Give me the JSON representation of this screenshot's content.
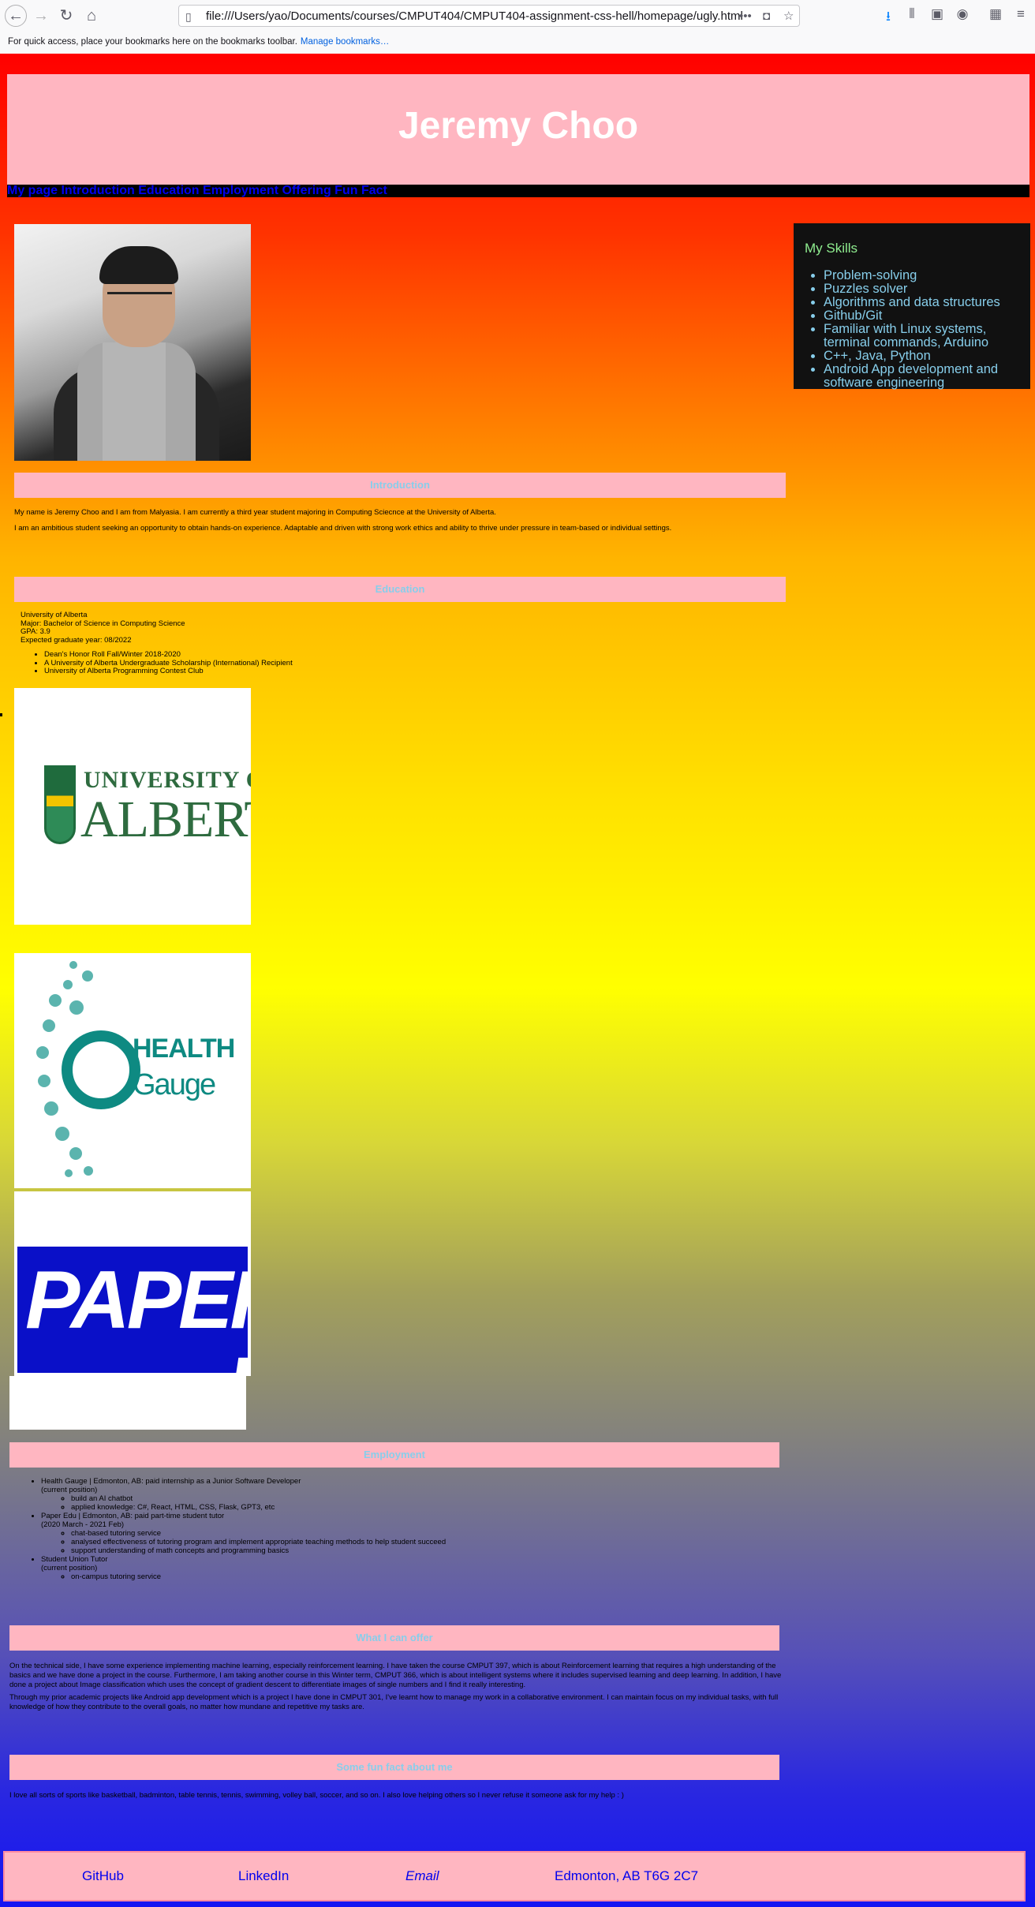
{
  "browser": {
    "url": "file:///Users/yao/Documents/courses/CMPUT404/CMPUT404-assignment-css-hell/homepage/ugly.html",
    "bookmarks_hint": "For quick access, place your bookmarks here on the bookmarks toolbar.",
    "manage_bookmarks": "Manage bookmarks…"
  },
  "header": {
    "title": "Jeremy Choo"
  },
  "nav": {
    "items": [
      "My page",
      "Introduction",
      "Education",
      "Employment",
      "Offering",
      "Fun Fact"
    ]
  },
  "skills": {
    "title": "My Skills",
    "items": [
      "Problem-solving",
      "Puzzles solver",
      "Algorithms and data structures",
      "Github/Git",
      "Familiar with Linux systems, terminal commands, Arduino",
      "C++, Java, Python",
      "Android App development and software engineering"
    ]
  },
  "introduction": {
    "heading": "Introduction",
    "p1": "My name is Jeremy Choo and I am from Malyasia. I am currently a third year student majoring in Computing Sciecnce at the University of Alberta.",
    "p2": "I am an ambitious student seeking an opportunity to obtain hands-on experience. Adaptable and driven with strong work ethics and ability to thrive under pressure in team-based or individual settings."
  },
  "education": {
    "heading": "Education",
    "school": "University of Alberta",
    "major": "Major: Bachelor of Science in Computing Science",
    "gpa": "GPA: 3.9",
    "graduate": "Expected graduate year: 08/2022",
    "honors": [
      "Dean's Honor Roll Fall/Winter 2018-2020",
      "A University of Alberta Undergraduate Scholarship (International) Recipient",
      "University of Alberta Programming Contest Club"
    ]
  },
  "logos": {
    "ualberta_of": "UNIVERSITY OF",
    "ualberta_name": "ALBERTA",
    "health": "HEALTH",
    "gauge": "Gauge",
    "paper": "PAPER"
  },
  "employment": {
    "heading": "Employment",
    "jobs": [
      {
        "title": "Health Gauge | Edmonton, AB: paid internship as a Junior Software Developer",
        "period": "(current position)",
        "details": [
          "build an AI chatbot",
          "applied knowledge: C#, React, HTML, CSS, Flask, GPT3, etc"
        ]
      },
      {
        "title": "Paper Edu | Edmonton, AB: paid part-time student tutor",
        "period": "(2020 March - 2021 Feb)",
        "details": [
          "chat-based tutoring service",
          "analysed effectiveness of tutoring program and implement appropriate teaching methods to help student succeed",
          "support understanding of math concepts and programming basics"
        ]
      },
      {
        "title": "Student Union Tutor",
        "period": "(current position)",
        "details": [
          "on-campus tutoring service"
        ]
      }
    ]
  },
  "offer": {
    "heading": "What I can offer",
    "p1": "On the technical side, I have some experience implementing machine learning, especially reinforcement learning. I have taken the course CMPUT 397, which is about Reinforcement learning that requires a high understanding of the basics and we have done a project in the course. Furthermore, I am taking another course in this Winter term, CMPUT 366, which is about intelligent systems where it includes supervised learning and deep learning. In addition, I have done a project about Image classification which uses the concept of gradient descent to differentiate images of single numbers and I find it really interesting.",
    "p2": "Through my prior academic projects like Android app development which is a project I have done in CMPUT 301, I've learnt how to manage my work in a collaborative environment. I can maintain focus on my individual tasks, with full knowledge of how they contribute to the overall goals, no matter how mundane and repetitive my tasks are."
  },
  "funfact": {
    "heading": "Some fun fact about me",
    "p1": "I love all sorts of sports like basketball, badminton, table tennis, tennis, swimming, volley ball, soccer, and so on. I also love helping others so I never refuse it someone ask for my help : )"
  },
  "footer": {
    "github": "GitHub",
    "linkedin": "LinkedIn",
    "email": "Email",
    "location": "Edmonton, AB T6G 2C7"
  },
  "colors": {
    "pink": "#ffb6c1",
    "skyblue": "#87ceeb",
    "lightgreen": "#90ee90",
    "link": "#0000ee"
  }
}
